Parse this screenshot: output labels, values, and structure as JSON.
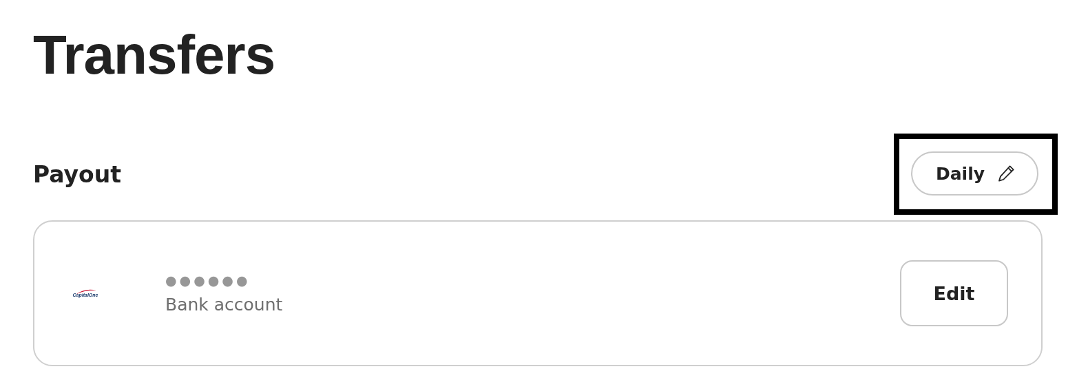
{
  "page_title": "Transfers",
  "payout": {
    "title": "Payout",
    "schedule_button": {
      "label": "Daily",
      "highlighted": true
    },
    "account": {
      "bank_logo": "CapitalOne",
      "masked_number": "●●●●●●",
      "type": "Bank account",
      "edit_button": "Edit"
    }
  }
}
